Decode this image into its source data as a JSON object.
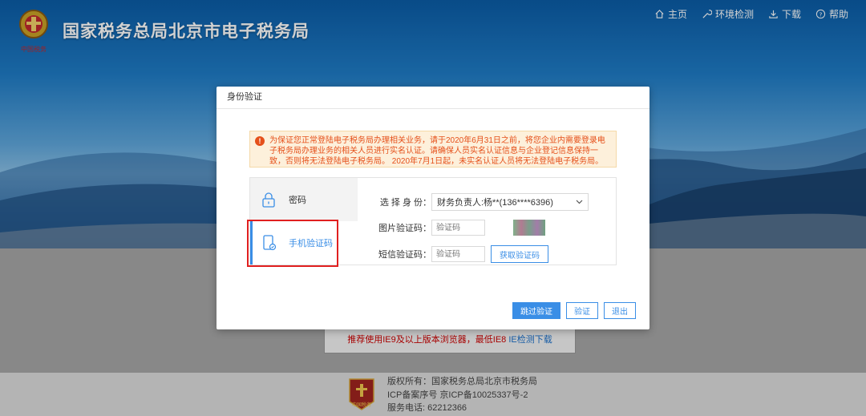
{
  "site": {
    "title": "国家税务总局北京市电子税务局",
    "logo_text": "中国税务"
  },
  "nav": [
    {
      "label": "主页",
      "icon": "home-icon"
    },
    {
      "label": "环境检测",
      "icon": "wrench-icon"
    },
    {
      "label": "下载",
      "icon": "download-icon"
    },
    {
      "label": "帮助",
      "icon": "help-icon"
    }
  ],
  "browser_tip": {
    "text": "推荐使用IE9及以上版本浏览器，最低IE8 ",
    "link": "IE检测下载"
  },
  "footer": {
    "emblem_text": "中国税务",
    "lines": [
      "版权所有：国家税务总局北京市税务局",
      "ICP备案序号 京ICP备10025337号-2",
      "服务电话: 62212366"
    ]
  },
  "modal": {
    "title": "身份验证",
    "notice": "为保证您正常登陆电子税务局办理相关业务，请于2020年6月31日之前，将您企业内需要登录电子税务局办理业务的相关人员进行实名认证。请确保人员实名认证信息与企业登记信息保持一致，否则将无法登陆电子税务局。 2020年7月1日起，未实名认证人员将无法登陆电子税务局。",
    "tabs": [
      {
        "label": "密码",
        "icon": "lock-icon",
        "active": false
      },
      {
        "label": "手机验证码",
        "icon": "mobile-icon",
        "active": true
      }
    ],
    "form": {
      "identity_label": "选 择 身 份：",
      "identity_value": "财务负责人:杨**(136****6396)",
      "captcha_label": "图片验证码：",
      "captcha_placeholder": "验证码",
      "sms_label": "短信验证码：",
      "sms_placeholder": "验证码",
      "get_code_button": "获取验证码"
    },
    "buttons": {
      "skip": "跳过验证",
      "verify": "验证",
      "exit": "退出"
    }
  },
  "colors": {
    "accent": "#3a8ee6",
    "notice_text": "#e5501a",
    "highlight": "#e02020"
  }
}
